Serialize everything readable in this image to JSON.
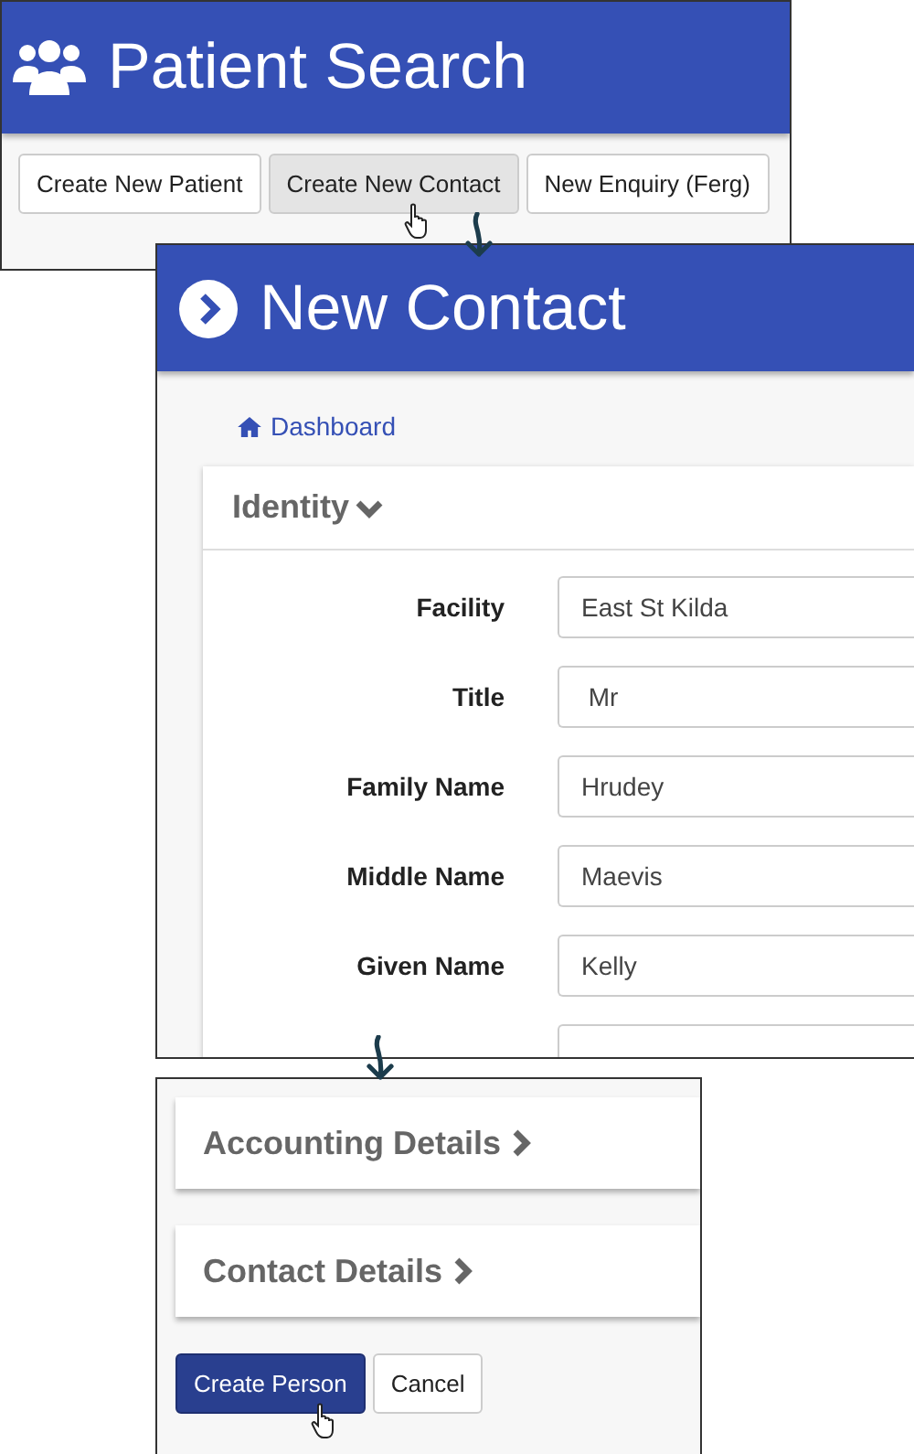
{
  "patient_search": {
    "title": "Patient Search",
    "buttons": [
      {
        "label": "Create New Patient",
        "selected": false
      },
      {
        "label": "Create New Contact",
        "selected": true
      },
      {
        "label": "New Enquiry (Ferg)",
        "selected": false
      }
    ]
  },
  "new_contact": {
    "title": "New Contact",
    "breadcrumb": "Dashboard",
    "section": {
      "title": "Identity",
      "expanded": true
    },
    "fields": [
      {
        "kind": "text",
        "label": "Facility",
        "value": "East St Kilda"
      },
      {
        "kind": "text",
        "label": "Title",
        "value": " Mr"
      },
      {
        "kind": "text",
        "label": "Family Name",
        "value": "Hrudey"
      },
      {
        "kind": "text",
        "label": "Middle Name",
        "value": "Maevis"
      },
      {
        "kind": "text",
        "label": "Given Name",
        "value": "Kelly"
      },
      {
        "kind": "blank"
      }
    ]
  },
  "footer": {
    "sections": [
      {
        "title": "Accounting Details",
        "expanded": false
      },
      {
        "title": "Contact Details",
        "expanded": false
      }
    ],
    "buttons": [
      {
        "label": "Create Person",
        "kind": "primary"
      },
      {
        "label": "Cancel",
        "kind": "default"
      }
    ]
  }
}
